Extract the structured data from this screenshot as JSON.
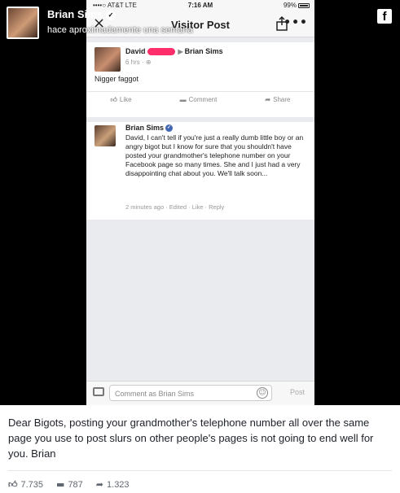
{
  "overlay": {
    "author": "Brian Sims",
    "time": "hace aproximadamente una semana",
    "logo_letter": "f"
  },
  "phone": {
    "carrier": "••••○ AT&T LTE",
    "time": "7:16 AM",
    "battery": "99%",
    "nav_close": "×",
    "nav_title": "Visitor Post",
    "nav_more": "•••",
    "post": {
      "author": "David",
      "recipient": "Brian Sims",
      "meta": "6 hrs · ⊕",
      "text": "Nigger faggot",
      "actions": [
        "Like",
        "Comment",
        "Share"
      ]
    },
    "comment": {
      "author": "Brian Sims",
      "body": "David, I can't tell if you're just a really dumb little boy or an angry bigot but I know for sure that you shouldn't have posted your grandmother's telephone number on your Facebook page so many times. She and I just had a very disappointing chat about you. We'll talk soon...",
      "meta": "2 minutes ago · Edited · Like · Reply"
    },
    "composer": {
      "placeholder": "Comment as Brian Sims",
      "post_label": "Post"
    }
  },
  "caption": "Dear Bigots, posting your grandmother's telephone number all over the same page you use to post slurs on other people's pages is not going to end well for you. Brian",
  "stats": {
    "likes": "7.735",
    "comments": "787",
    "shares": "1.323"
  }
}
